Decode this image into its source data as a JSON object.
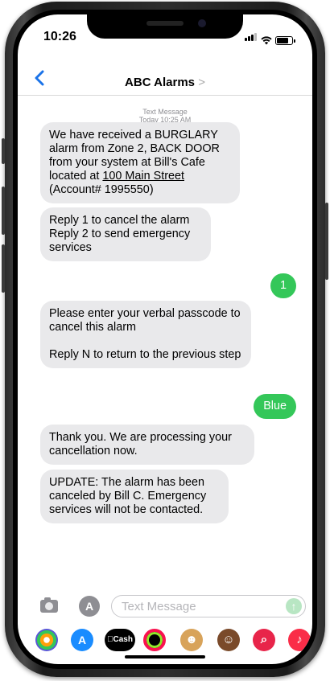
{
  "status": {
    "time": "10:26"
  },
  "nav": {
    "back_icon": "chevron-left-icon",
    "title": "ABC Alarms",
    "title_chevron": ">"
  },
  "meta": {
    "label": "Text Message",
    "timestamp": "Today 10:25 AM"
  },
  "messages": [
    {
      "direction": "in",
      "text": "We have received a BURGLARY alarm from Zone 2, BACK DOOR from your system at Bill's Cafe located at ",
      "link": "100 Main Street",
      "after": "\n(Account# 1995550)"
    },
    {
      "direction": "in",
      "text": "Reply 1 to cancel the alarm\nReply 2 to send emergency services"
    },
    {
      "direction": "out",
      "text": "1"
    },
    {
      "direction": "in",
      "text": "Please enter your verbal passcode to cancel this alarm\n\nReply N to return to the previous step"
    },
    {
      "direction": "out",
      "text": "Blue"
    },
    {
      "direction": "in",
      "text": "Thank you. We are processing your cancellation now."
    },
    {
      "direction": "in",
      "text": "UPDATE: The alarm has been canceled by Bill C. Emergency services will not be contacted."
    }
  ],
  "composer": {
    "placeholder": "Text Message",
    "camera_icon": "camera-icon",
    "apps_icon": "app-store-icon",
    "send_icon": "send-arrow-icon"
  },
  "app_strip": [
    {
      "name": "photos-icon",
      "color": "#ff9f0a"
    },
    {
      "name": "app-store-icon",
      "color": "#1a8cff"
    },
    {
      "name": "cash-icon",
      "label": "Cash",
      "color": "#000000"
    },
    {
      "name": "activity-icon",
      "color": "#000000"
    },
    {
      "name": "memoji-icon",
      "color": "#d8a35a"
    },
    {
      "name": "animoji-icon",
      "color": "#7a4a2a"
    },
    {
      "name": "search-images-icon",
      "color": "#e8254a"
    },
    {
      "name": "music-icon",
      "color": "#fa2d48"
    }
  ],
  "colors": {
    "accent": "#1a73e8",
    "outgoing": "#34c759",
    "incoming": "#e9e9eb"
  }
}
